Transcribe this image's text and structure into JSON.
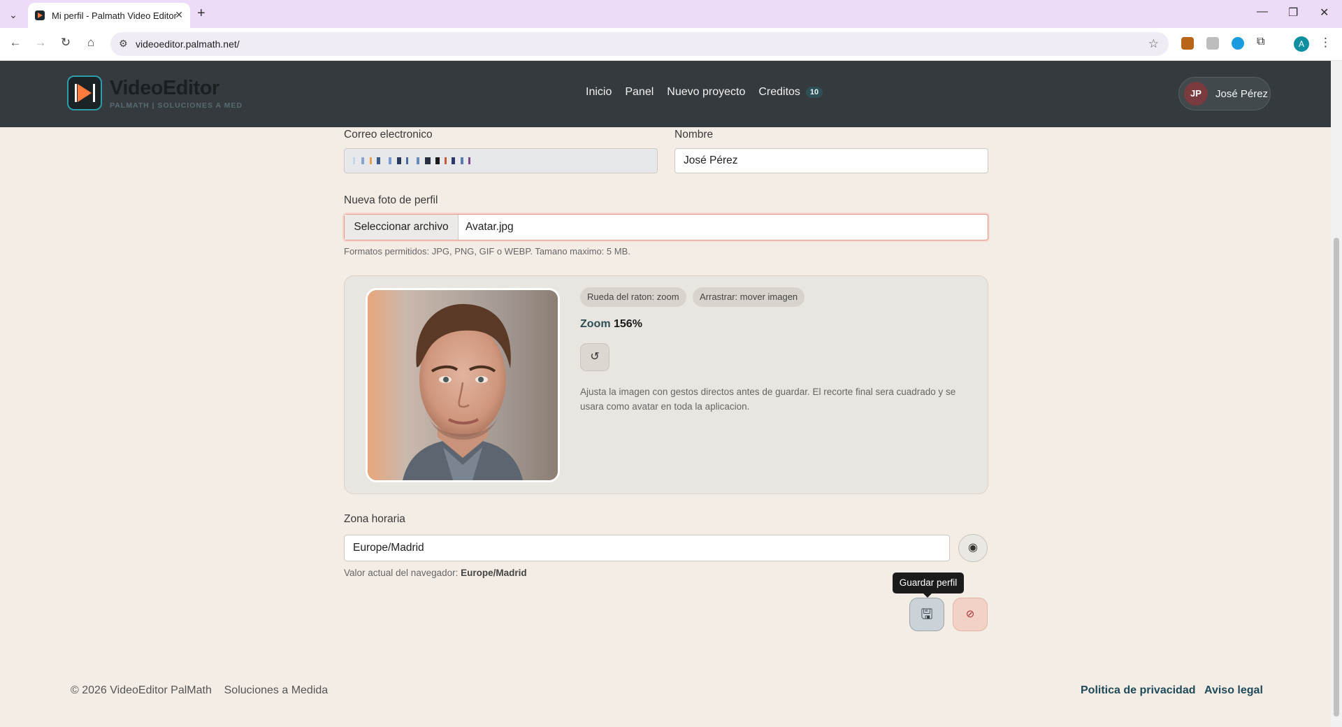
{
  "browser": {
    "tab_title": "Mi perfil - Palmath Video Editor",
    "url": "videoeditor.palmath.net/",
    "profile_initial": "A"
  },
  "header": {
    "brand_name": "VideoEditor",
    "brand_tagline": "PALMATH | SOLUCIONES A MED",
    "nav": {
      "inicio": "Inicio",
      "panel": "Panel",
      "nuevo_proyecto": "Nuevo proyecto",
      "creditos": "Creditos",
      "creditos_count": "10"
    },
    "user": {
      "initials": "JP",
      "name": "José Pérez"
    }
  },
  "form": {
    "email_label": "Correo electronico",
    "name_label": "Nombre",
    "name_value": "José Pérez",
    "photo_label": "Nueva foto de perfil",
    "file_button": "Seleccionar archivo",
    "file_name": "Avatar.jpg",
    "file_hint": "Formatos permitidos: JPG, PNG, GIF o WEBP. Tamano maximo: 5 MB.",
    "cropper": {
      "chip_zoom": "Rueda del raton: zoom",
      "chip_drag": "Arrastrar: mover imagen",
      "zoom_label": "Zoom",
      "zoom_value": "156%",
      "description": "Ajusta la imagen con gestos directos antes de guardar. El recorte final sera cuadrado y se usara como avatar en toda la aplicacion."
    },
    "timezone_label": "Zona horaria",
    "timezone_value": "Europe/Madrid",
    "timezone_hint_prefix": "Valor actual del navegador:",
    "timezone_hint_value": "Europe/Madrid",
    "save_tooltip": "Guardar perfil"
  },
  "footer": {
    "copyright": "© 2026 VideoEditor PalMath",
    "tagline": "Soluciones a Medida",
    "privacy": "Politica de privacidad",
    "legal": "Aviso legal"
  },
  "colors": {
    "header_bg": "#343a3e",
    "accent_orange": "#ff7a3d",
    "accent_teal": "#2e4f55",
    "page_bg": "#f4ede5"
  }
}
